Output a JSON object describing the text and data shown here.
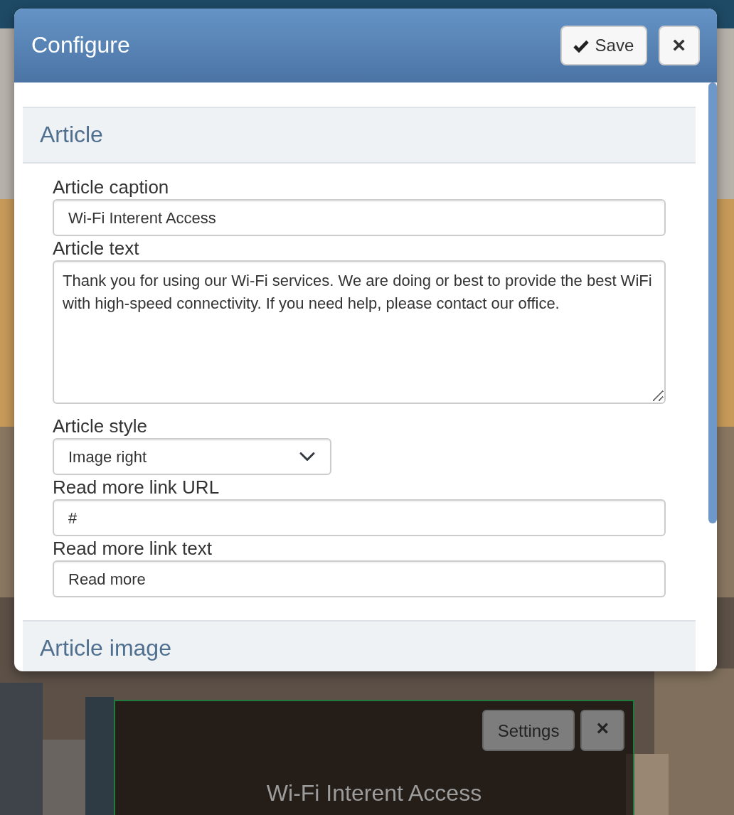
{
  "modal": {
    "title": "Configure",
    "buttons": [
      {
        "kind": "save",
        "label": "Save"
      },
      {
        "kind": "close",
        "label": "×"
      }
    ],
    "sections": [
      {
        "title": "Article",
        "fields": [
          {
            "kind": "text",
            "label": "Article caption",
            "value": "Wi-Fi Interent Access"
          },
          {
            "kind": "textarea",
            "label": "Article text",
            "value": "Thank you for using our Wi-Fi services. We are doing or best to provide the best WiFi with high-speed connectivity. If you need help, please contact our office."
          },
          {
            "kind": "select",
            "label": "Article style",
            "value": "Image right"
          },
          {
            "kind": "text",
            "label": "Read more link URL",
            "value": "#"
          },
          {
            "kind": "text",
            "label": "Read more link text",
            "value": "Read more"
          }
        ]
      },
      {
        "title": "Article image"
      }
    ]
  },
  "widget": {
    "buttons": [
      {
        "kind": "settings",
        "label": "Settings"
      },
      {
        "kind": "close",
        "label": "×"
      }
    ],
    "heading": "Wi-Fi Interent Access"
  }
}
